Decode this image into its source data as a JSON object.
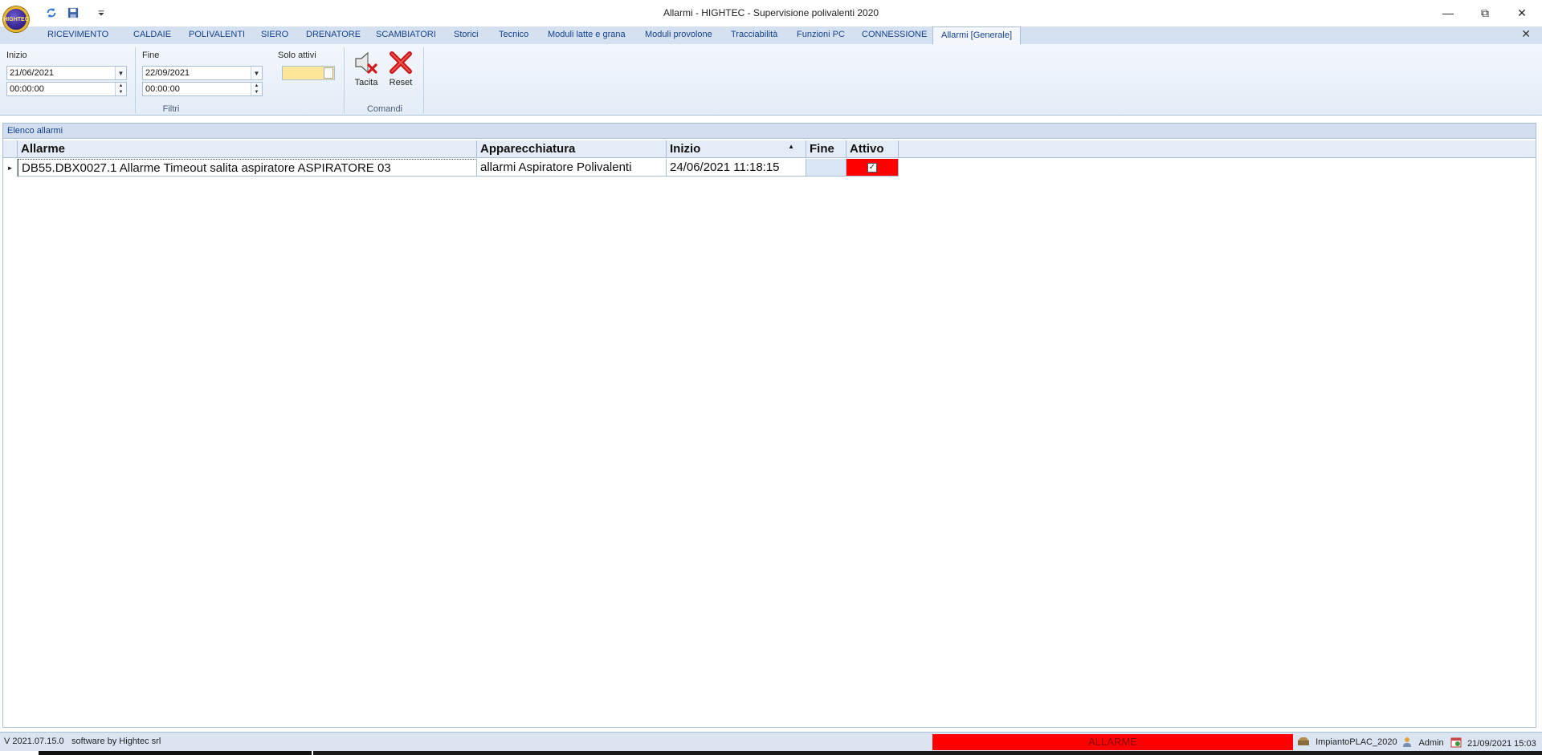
{
  "window": {
    "title": "Allarmi - HIGHTEC - Supervisione polivalenti 2020",
    "logo_text": "HIGHTEC",
    "qat_icons": [
      "refresh-icon",
      "save-icon",
      "customize-qat-icon"
    ]
  },
  "tabs": [
    {
      "label": "RICEVIMENTO"
    },
    {
      "label": "CALDAIE"
    },
    {
      "label": "POLIVALENTI"
    },
    {
      "label": "SIERO"
    },
    {
      "label": "DRENATORE"
    },
    {
      "label": "SCAMBIATORI"
    },
    {
      "label": "Storici"
    },
    {
      "label": "Tecnico"
    },
    {
      "label": "Moduli latte e grana"
    },
    {
      "label": "Moduli provolone"
    },
    {
      "label": "Tracciabilità"
    },
    {
      "label": "Funzioni PC"
    },
    {
      "label": "CONNESSIONE"
    },
    {
      "label": "Allarmi  [Generale]",
      "active": true
    }
  ],
  "ribbon": {
    "filtri": {
      "caption": "Filtri",
      "inizio_label": "Inizio",
      "inizio_date": "21/06/2021",
      "inizio_time": "00:00:00",
      "fine_label": "Fine",
      "fine_date": "22/09/2021",
      "fine_time": "00:00:00",
      "solo_attivi_label": "Solo attivi",
      "solo_attivi_on": true
    },
    "comandi": {
      "caption": "Comandi",
      "tacita_label": "Tacita",
      "reset_label": "Reset"
    }
  },
  "panel": {
    "title": "Elenco allarmi",
    "columns": [
      "Allarme",
      "Apparecchiatura",
      "Inizio",
      "Fine",
      "Attivo"
    ],
    "sorted_column": "Inizio",
    "sort_direction": "ascending",
    "rows": [
      {
        "allarme": "DB55.DBX0027.1 Allarme Timeout salita aspiratore  ASPIRATORE 03",
        "apparecchiatura": "allarmi Aspiratore Polivalenti",
        "inizio": "24/06/2021 11:18:15",
        "fine": "",
        "attivo": true
      }
    ]
  },
  "statusbar": {
    "version": "V 2021.07.15.0",
    "credits": "software by Hightec srl",
    "alarm_text": "ALLARME",
    "plant": "ImpiantoPLAC_2020",
    "user": "Admin",
    "datetime": "21/09/2021 15:03"
  },
  "colors": {
    "accent": "#15428b",
    "tab_bar": "#d5e1f1",
    "alarm_red": "#ff0000",
    "toggle_on": "#fde69a"
  }
}
